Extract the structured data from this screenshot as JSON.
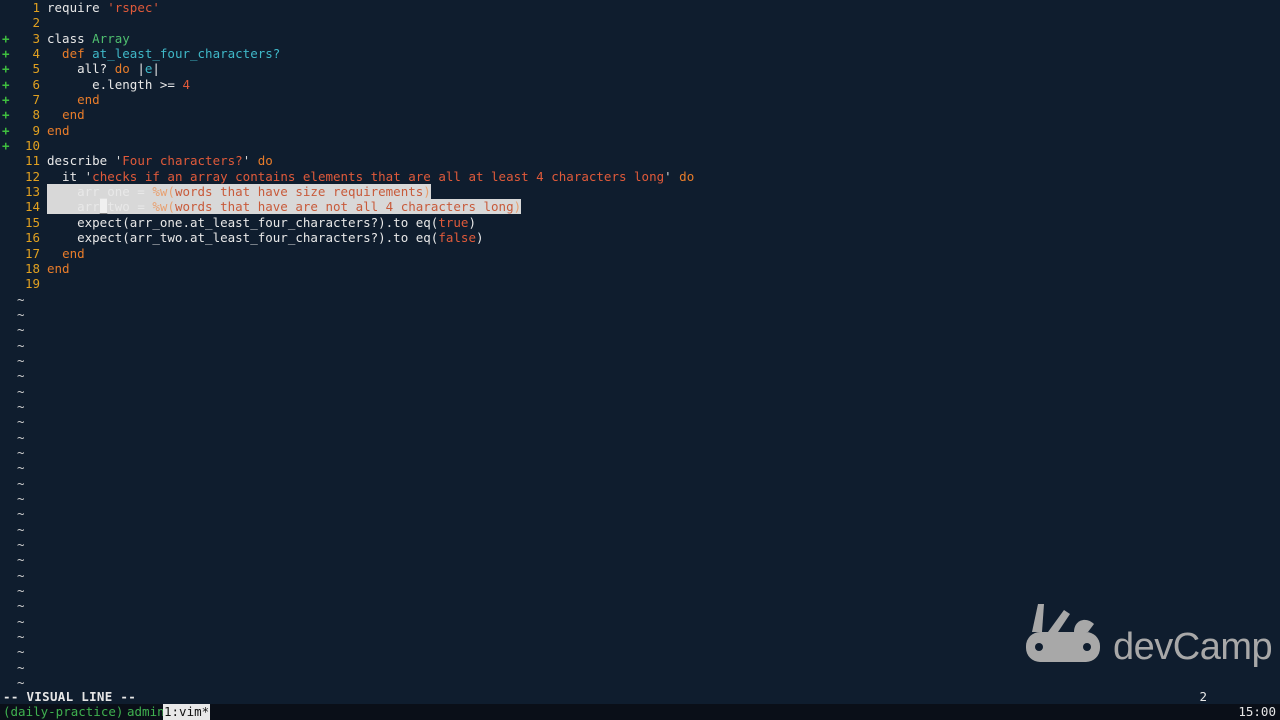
{
  "editor": {
    "lines": [
      {
        "n": "1",
        "sign": "",
        "html_key": "l1"
      },
      {
        "n": "2",
        "sign": "",
        "html_key": "l2"
      },
      {
        "n": "3",
        "sign": "+",
        "html_key": "l3"
      },
      {
        "n": "4",
        "sign": "+",
        "html_key": "l4"
      },
      {
        "n": "5",
        "sign": "+",
        "html_key": "l5"
      },
      {
        "n": "6",
        "sign": "+",
        "html_key": "l6"
      },
      {
        "n": "7",
        "sign": "+",
        "html_key": "l7"
      },
      {
        "n": "8",
        "sign": "+",
        "html_key": "l8"
      },
      {
        "n": "9",
        "sign": "+",
        "html_key": "l9"
      },
      {
        "n": "10",
        "sign": "+",
        "html_key": "l10"
      },
      {
        "n": "11",
        "sign": "",
        "html_key": "l11"
      },
      {
        "n": "12",
        "sign": "",
        "html_key": "l12"
      },
      {
        "n": "13",
        "sign": "",
        "html_key": "l13"
      },
      {
        "n": "14",
        "sign": "",
        "html_key": "l14"
      },
      {
        "n": "15",
        "sign": "",
        "html_key": "l15"
      },
      {
        "n": "16",
        "sign": "",
        "html_key": "l16"
      },
      {
        "n": "17",
        "sign": "",
        "html_key": "l17"
      },
      {
        "n": "18",
        "sign": "",
        "html_key": "l18"
      },
      {
        "n": "19",
        "sign": "",
        "html_key": "l19"
      }
    ],
    "code": {
      "l1": [
        "require ",
        "'rspec'"
      ],
      "l3": [
        "class ",
        "Array"
      ],
      "l4": [
        "  def ",
        "at_least_four_characters?"
      ],
      "l5": [
        "    all? ",
        "do",
        " |",
        "e",
        "|"
      ],
      "l6": [
        "      e.length >= ",
        "4"
      ],
      "l7": [
        "    ",
        "end"
      ],
      "l8": [
        "  ",
        "end"
      ],
      "l9": [
        "end"
      ],
      "l11": [
        "describe ",
        "'",
        "Four characters?",
        "'",
        " do"
      ],
      "l12": [
        "  it ",
        "'",
        "checks if an array contains elements that are all at least 4 characters long",
        "'",
        " do"
      ],
      "l13": [
        "    arr_one = ",
        "%w(",
        "words that have size requirements",
        ")"
      ],
      "l14": [
        "    arr",
        "_",
        "two = ",
        "%w(",
        "words that have are not all 4 characters long",
        ")"
      ],
      "l15": [
        "    expect(arr_one.at_least_four_characters?).to eq(",
        "true",
        ")"
      ],
      "l16": [
        "    expect(arr_two.at_least_four_characters?).to eq(",
        "false",
        ")"
      ],
      "l17": [
        "  ",
        "end"
      ],
      "l18": [
        "end"
      ]
    },
    "tilde": "~",
    "tilde_count": 26
  },
  "status": {
    "mode": "-- VISUAL LINE --",
    "selection_count": "2"
  },
  "tmux": {
    "session": "(daily-practice)",
    "user": "admin",
    "window": "1:vim*",
    "time": "15:00"
  },
  "logo": {
    "text": "devCamp"
  },
  "colors": {
    "background": "#0f1d2e",
    "line_number": "#e0a020",
    "diff_add_sign": "#3fbf3f",
    "string": "#e05a3a",
    "class_name": "#4fbf6f",
    "method_name": "#3fb8c8",
    "selection": "#d8d8d8"
  }
}
